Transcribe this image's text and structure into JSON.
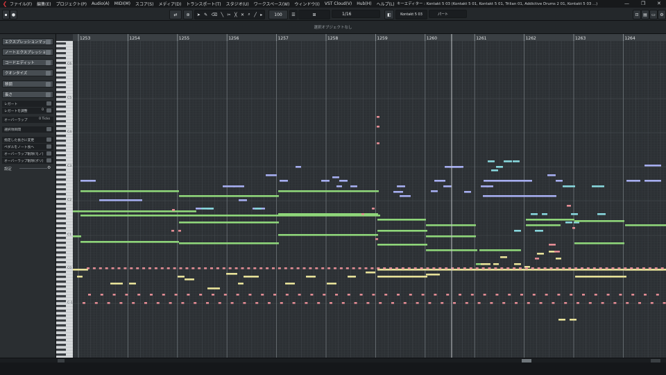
{
  "menu": {
    "items": [
      "ファイル(F)",
      "編集(E)",
      "プロジェクト(P)",
      "Audio(A)",
      "MIDI(M)",
      "スコア(S)",
      "メディア(D)",
      "トランスポート(T)",
      "スタジオ(U)",
      "ワークスペース(W)",
      "ウィンドウ(I)",
      "VST Cloud(V)",
      "Hub(H)",
      "ヘルプ(L)"
    ]
  },
  "window": {
    "title": "キーエディター : Kontakt 5 03 (Kontakt 5 01, Kontakt 5 01, Trilian 01, Addictive Drums 2 01, Kontakt 5 03 ...)"
  },
  "toolbar": {
    "zoom_value": "100",
    "quantize_value": "1/16",
    "instrument": "Kontakt 5 03",
    "part_label": "パート"
  },
  "infoline": {
    "text": "選択オブジェクトなし"
  },
  "left_panel": {
    "sections": [
      "エクスプレッションマップ",
      "ノートエクスプレッション",
      "コードエディット",
      "クオンタイズ",
      "移調",
      "長さ"
    ],
    "rows": [
      {
        "label": "レガート",
        "value": ""
      },
      {
        "label": "レガートを調整",
        "value": "0"
      },
      {
        "label": "オーバーラップ",
        "value": "0 Ticks"
      },
      {
        "label": "選択項目間",
        "value": ""
      },
      {
        "label": "指定した長さに変更",
        "value": ""
      },
      {
        "label": "ペダルをノート長へ",
        "value": ""
      },
      {
        "label": "オーバーラップ削除(モノ)",
        "value": ""
      },
      {
        "label": "オーバーラップ削除(ポリ)",
        "value": ""
      }
    ],
    "settings_label": "設定"
  },
  "ruler": {
    "bars": [
      "1253",
      "1254",
      "1255",
      "1256",
      "1257",
      "1258",
      "1259",
      "1260",
      "1261",
      "1262",
      "1263",
      "1264"
    ]
  },
  "keys": {
    "octave_labels": [
      "C6",
      "C5",
      "C4",
      "C3",
      "C2",
      "C1",
      "C0",
      "C-1"
    ]
  },
  "colors": {
    "green": "#8fd67a",
    "blue": "#a6aef0",
    "cyan": "#87d6dc",
    "yellow": "#e7e199",
    "pink": "#e48c94"
  }
}
